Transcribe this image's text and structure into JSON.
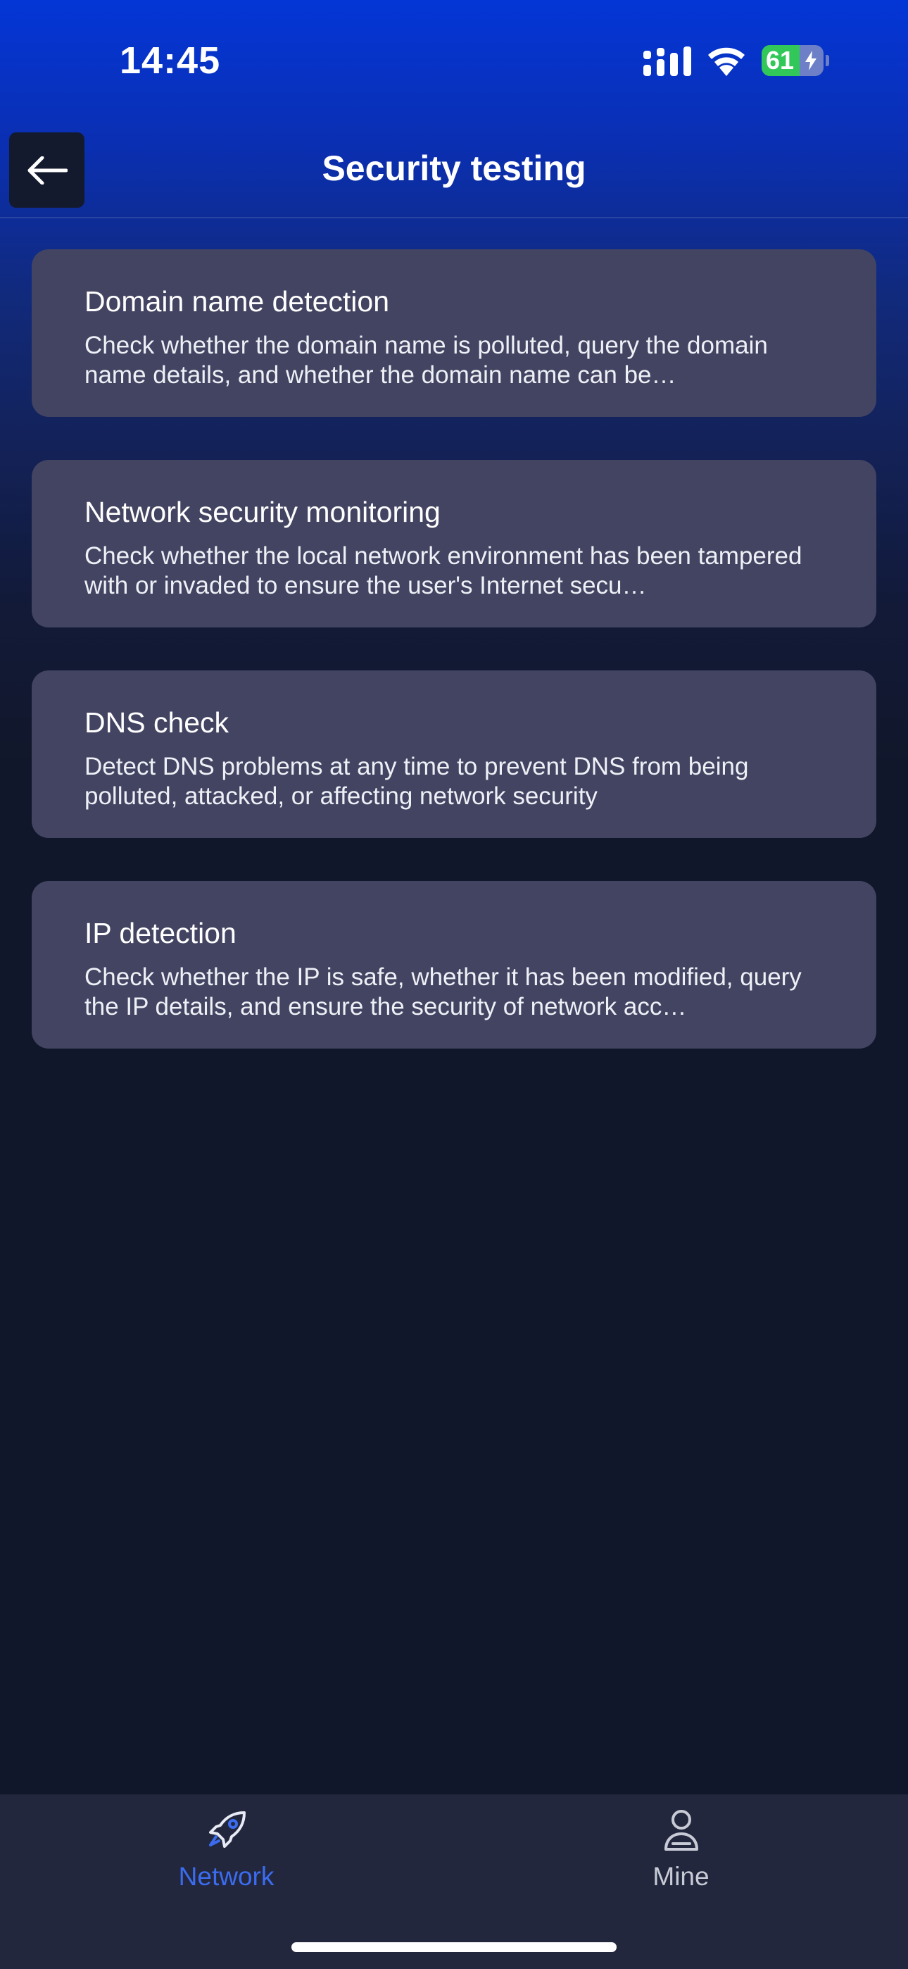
{
  "status_bar": {
    "time": "14:45",
    "battery_percent": 61,
    "battery_label": "61",
    "icons": [
      "signal-icon",
      "wifi-icon",
      "battery-icon",
      "charging-bolt-icon"
    ]
  },
  "nav": {
    "title": "Security testing",
    "back_icon": "arrow-left-icon"
  },
  "cards": [
    {
      "title": "Domain name detection",
      "description": "Check whether the domain name is polluted, query the domain name details, and whether the domain name can be…"
    },
    {
      "title": "Network security monitoring",
      "description": "Check whether the local network environment has been tampered with or invaded to ensure the user's Internet secu…"
    },
    {
      "title": "DNS check",
      "description": "Detect DNS problems at any time to prevent DNS from being polluted, attacked, or affecting network security"
    },
    {
      "title": "IP detection",
      "description": "Check whether the IP is safe, whether it has been modified, query the IP details, and ensure the security of network acc…"
    }
  ],
  "tab_bar": {
    "tabs": [
      {
        "label": "Network",
        "icon": "rocket-icon",
        "active": true
      },
      {
        "label": "Mine",
        "icon": "person-icon",
        "active": false
      }
    ]
  },
  "colors": {
    "accent": "#3b6cf0",
    "card_bg": "#434462",
    "page_bg": "#11172a",
    "header_blue": "#0436d6",
    "battery_green": "#31c759"
  }
}
